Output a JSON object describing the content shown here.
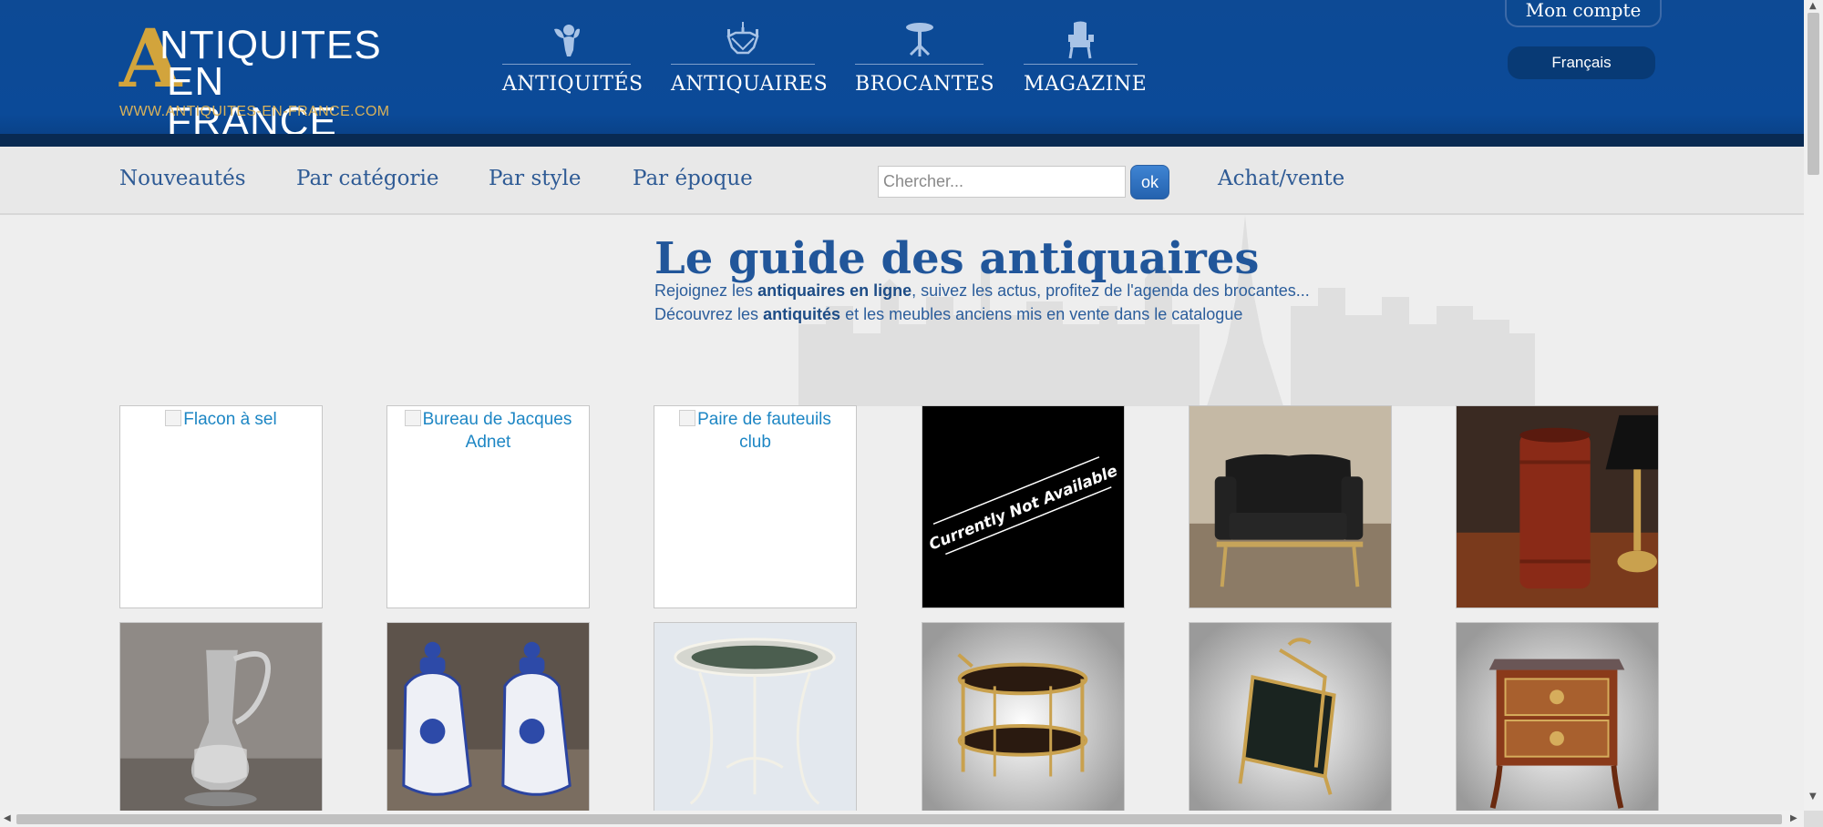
{
  "header": {
    "logo": {
      "big_letter": "A",
      "line1": "NTIQUITES",
      "line2": "EN FRANCE",
      "url": "WWW.ANTIQUITES-EN-FRANCE.COM"
    },
    "nav": [
      {
        "label": "ANTIQUITÉS",
        "icon": "cherub-icon"
      },
      {
        "label": "ANTIQUAIRES",
        "icon": "chandelier-icon"
      },
      {
        "label": "BROCANTES",
        "icon": "gueridon-table-icon"
      },
      {
        "label": "MAGAZINE",
        "icon": "armchair-icon"
      }
    ],
    "account_label": "Mon compte",
    "language": "Français"
  },
  "subnav": {
    "links": [
      "Nouveautés",
      "Par catégorie",
      "Par style",
      "Par époque"
    ],
    "search_placeholder": "Chercher...",
    "search_button": "ok",
    "buy_sell": "Achat/vente"
  },
  "main": {
    "title": "Le guide des antiquaires",
    "intro_line1": {
      "a": "Rejoignez les ",
      "b": "antiquaires en ligne",
      "c": ", suivez les actus, profitez de l'agenda des brocantes..."
    },
    "intro_line2": {
      "a": "Découvrez les ",
      "b": "antiquités",
      "c": " et les meubles anciens mis en vente dans le catalogue"
    }
  },
  "products": [
    {
      "alt": "Flacon à sel",
      "state": "broken-image"
    },
    {
      "alt": "Bureau de Jacques Adnet",
      "state": "broken-image"
    },
    {
      "alt": "Paire de fauteuils club",
      "state": "broken-image"
    },
    {
      "placeholder_text": "Currently Not Available",
      "state": "unavailable"
    },
    {
      "picture": "black leather loveseat",
      "state": "photo"
    },
    {
      "picture": "red cylinder vase and lamp",
      "state": "photo"
    },
    {
      "picture": "crystal and silver claret jug",
      "state": "photo"
    },
    {
      "picture": "pair of blue and white delft jars",
      "state": "photo"
    },
    {
      "picture": "white wire plant stand",
      "state": "photo"
    },
    {
      "picture": "brass oval serving trolley",
      "state": "photo"
    },
    {
      "picture": "brass magazine rack",
      "state": "photo"
    },
    {
      "picture": "marquetry commode",
      "state": "photo"
    }
  ]
}
